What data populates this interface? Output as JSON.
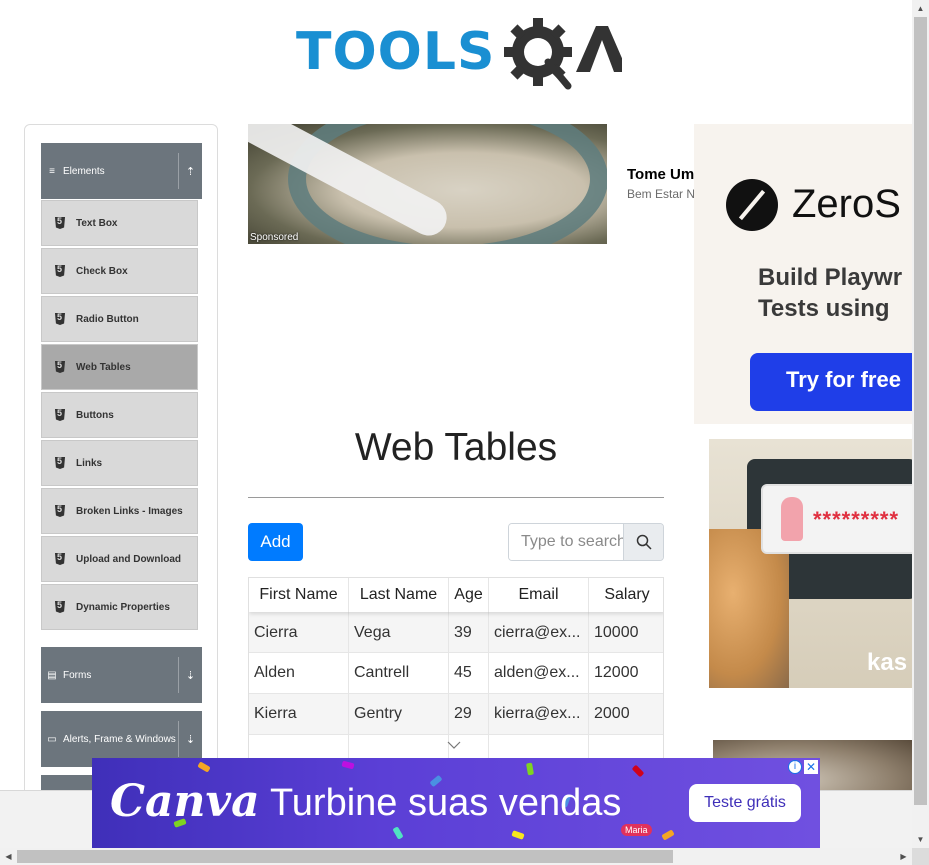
{
  "logo": {
    "text_tools": "TOOLS",
    "text_qa": "QA"
  },
  "sidebar": {
    "groups": [
      {
        "label": "Elements",
        "toggle": "⇡"
      },
      {
        "label": "Forms",
        "toggle": "⇣"
      },
      {
        "label": "Alerts, Frame & Windows",
        "toggle": "⇣"
      }
    ],
    "items": [
      {
        "label": "Text Box"
      },
      {
        "label": "Check Box"
      },
      {
        "label": "Radio Button"
      },
      {
        "label": "Web Tables",
        "active": true
      },
      {
        "label": "Buttons"
      },
      {
        "label": "Links"
      },
      {
        "label": "Broken Links - Images"
      },
      {
        "label": "Upload and Download"
      },
      {
        "label": "Dynamic Properties"
      }
    ]
  },
  "ads": {
    "food": {
      "sponsored": "Sponsored",
      "title": "Tome Um",
      "subtitle": "Bem Estar N"
    },
    "zerostep": {
      "name": "ZeroS",
      "tagline_1": "Build Playwr",
      "tagline_2": "Tests using",
      "cta": "Try for free"
    },
    "kaspersky": {
      "password": "*********",
      "brand": "kas"
    },
    "canva": {
      "logo": "Canva",
      "tagline": "Turbine suas vendas",
      "cta": "Teste grátis",
      "tag": "Maria",
      "info": "i",
      "close": "✕"
    }
  },
  "main": {
    "title": "Web Tables",
    "add_label": "Add",
    "search": {
      "placeholder": "Type to search",
      "value": ""
    }
  },
  "table": {
    "headers": [
      "First Name",
      "Last Name",
      "Age",
      "Email",
      "Salary"
    ],
    "rows": [
      [
        "Cierra",
        "Vega",
        "39",
        "cierra@ex...",
        "10000"
      ],
      [
        "Alden",
        "Cantrell",
        "45",
        "alden@ex...",
        "12000"
      ],
      [
        "Kierra",
        "Gentry",
        "29",
        "kierra@ex...",
        "2000"
      ]
    ]
  },
  "colors": {
    "primary": "#007bff",
    "logo_blue": "#1a8fd2",
    "sidebar_header": "#6c757d",
    "canva_purple": "#5b3fd6"
  }
}
